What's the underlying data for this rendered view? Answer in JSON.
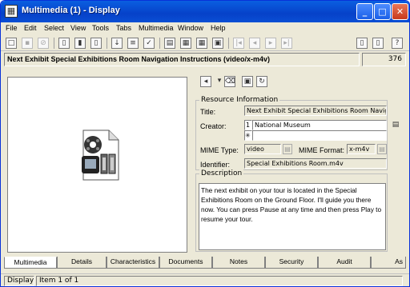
{
  "window": {
    "title": "Multimedia (1) - Display"
  },
  "menu": [
    "File",
    "Edit",
    "Select",
    "View",
    "Tools",
    "Tabs",
    "Multimedia",
    "Window",
    "Help"
  ],
  "record": {
    "title": "Next Exhibit Special Exhibitions Room Navigation Instructions (video/x-m4v)",
    "number": "376"
  },
  "resource": {
    "legend": "Resource Information",
    "title_label": "Title:",
    "title_value": "Next Exhibit Special Exhibitions Room Navigati",
    "creator_label": "Creator:",
    "creator_index": "1",
    "creator_value": "National Museum",
    "new_row_marker": "✳",
    "mime_type_label": "MIME Type:",
    "mime_type_value": "video",
    "mime_format_label": "MIME Format:",
    "mime_format_value": "x-m4v",
    "identifier_label": "Identifier:",
    "identifier_value": "Special Exhibitions Room.m4v"
  },
  "description": {
    "legend": "Description",
    "text": "The next exhibit on your tour is located in the Special Exhibitions Room on the Ground Floor. I'll guide you there now. You can press Pause at any time and then press Play to resume your tour."
  },
  "tabs": [
    "Multimedia",
    "Details",
    "Characteristics",
    "Documents",
    "Notes",
    "Security",
    "Audit",
    "As"
  ],
  "status": {
    "mode": "Display",
    "item": "Item 1 of 1"
  }
}
